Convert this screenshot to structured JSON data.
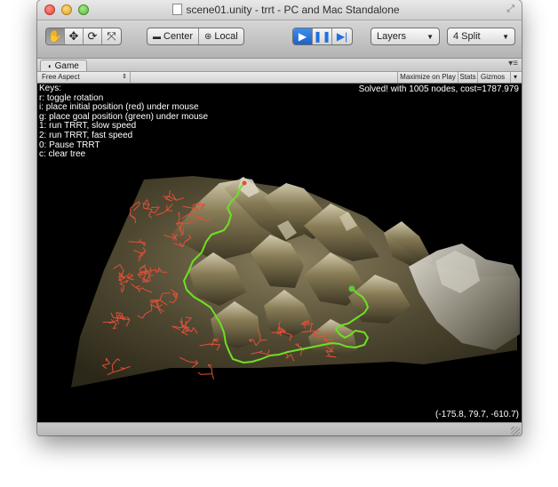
{
  "window": {
    "title": "scene01.unity - trrt - PC and Mac Standalone"
  },
  "toolbar": {
    "transform_tools": [
      {
        "icon": "hand-icon",
        "glyph": "✋",
        "active": true
      },
      {
        "icon": "move-icon",
        "glyph": "✥",
        "active": false
      },
      {
        "icon": "rotate-icon",
        "glyph": "⟳",
        "active": false
      },
      {
        "icon": "scale-icon",
        "glyph": "⤧",
        "active": false
      }
    ],
    "pivot_label": "Center",
    "space_label": "Local",
    "play_controls": [
      {
        "icon": "play-icon",
        "glyph": "▶",
        "active": true
      },
      {
        "icon": "pause-icon",
        "glyph": "❚❚",
        "active": false
      },
      {
        "icon": "step-icon",
        "glyph": "▶|",
        "active": false
      }
    ],
    "layers_label": "Layers",
    "layout_label": "4 Split"
  },
  "game_tab": {
    "label": "Game",
    "aspect": "Free Aspect",
    "maximize_on_play": "Maximize on Play",
    "stats": "Stats",
    "gizmos": "Gizmos"
  },
  "overlay": {
    "keys_title": "Keys:",
    "keys": [
      "r: toggle rotation",
      "i: place initial position (red) under mouse",
      "g: place goal position (green) under mouse",
      "1: run TRRT, slow speed",
      "2: run TRRT, fast speed",
      "0: Pause TRRT",
      "c: clear tree"
    ],
    "status": "Solved! with 1005 nodes, cost=1787.979",
    "coordinates": "(-175.8, 79.7, -610.7)"
  },
  "colors": {
    "tree_edges": "#e0503a",
    "solution_path": "#6ee024",
    "goal_marker": "#62c83c",
    "terrain_dark": "#3f3a28",
    "terrain_light": "#b8ad86"
  }
}
